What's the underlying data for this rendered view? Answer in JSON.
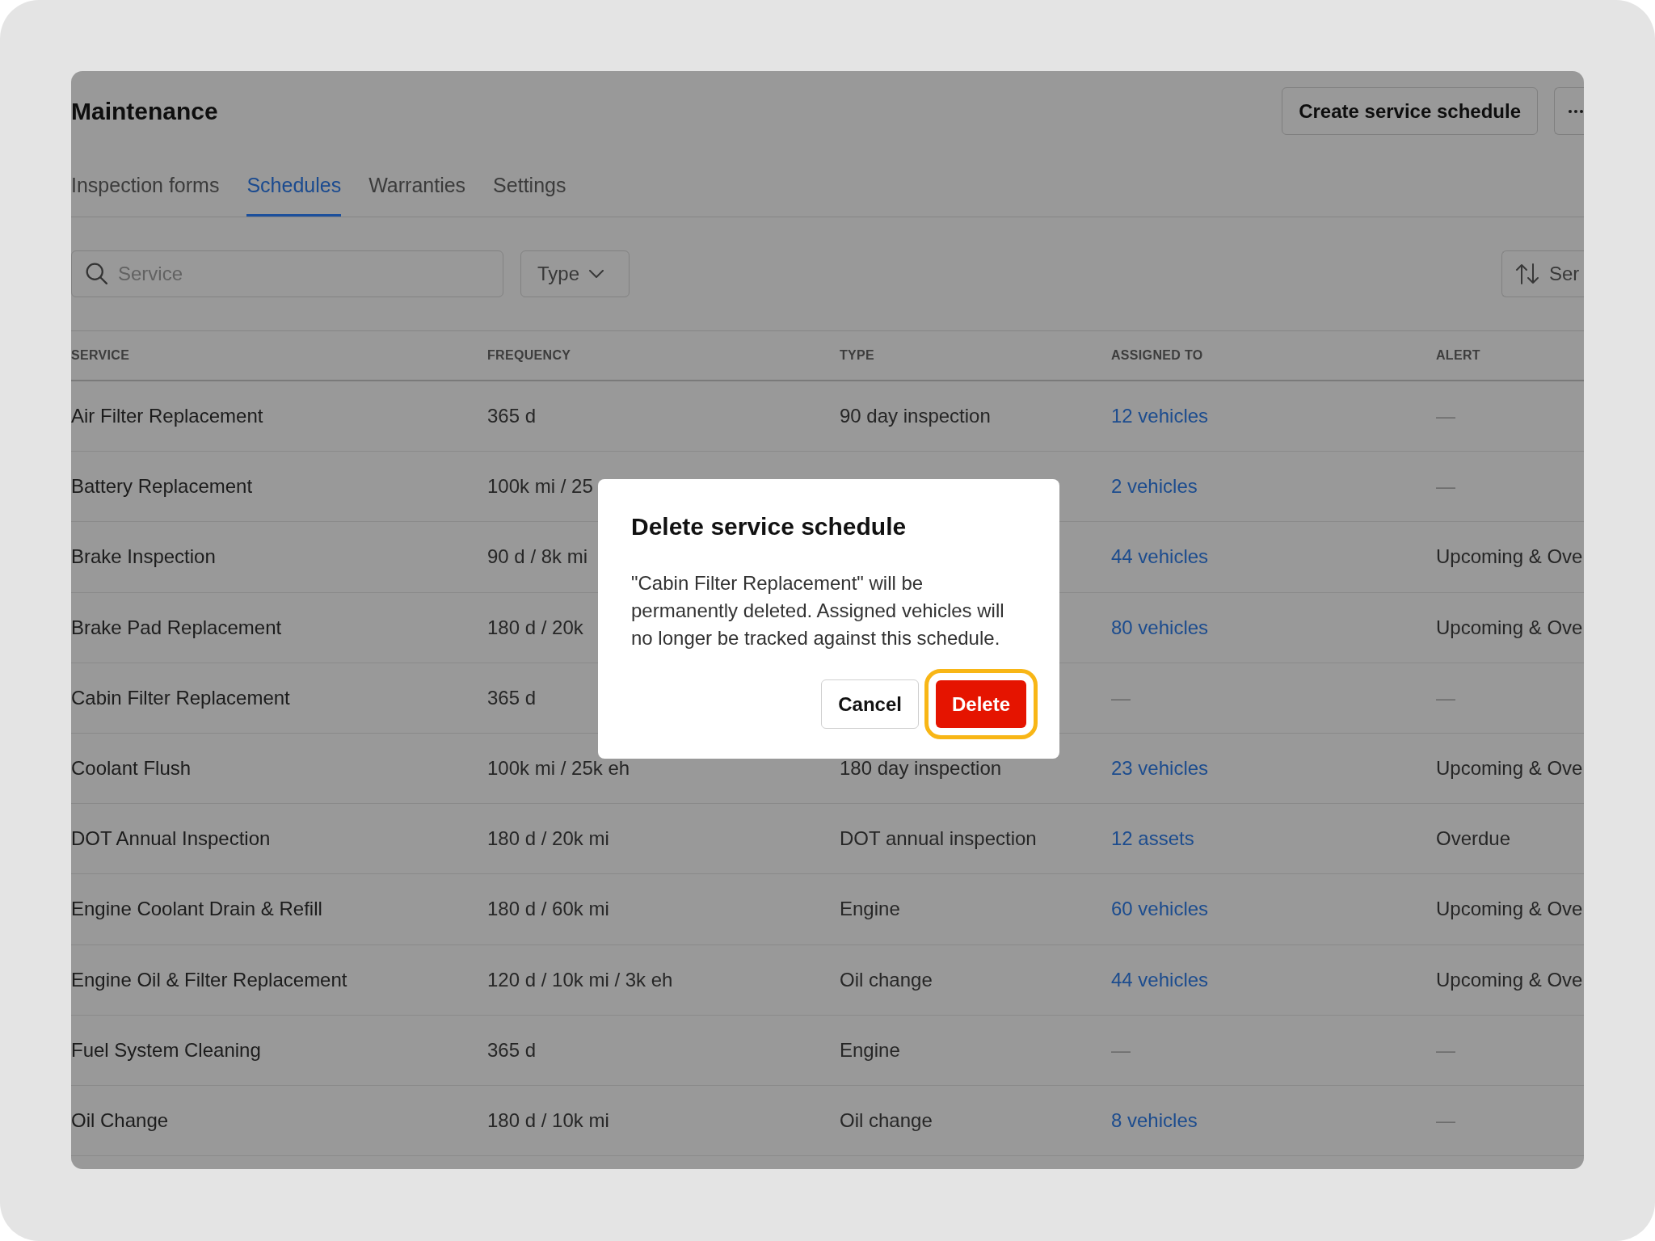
{
  "header": {
    "title": "Maintenance",
    "create_button": "Create service schedule"
  },
  "tabs": [
    {
      "label": "Inspection forms",
      "selected": false
    },
    {
      "label": "Schedules",
      "selected": true
    },
    {
      "label": "Warranties",
      "selected": false
    },
    {
      "label": "Settings",
      "selected": false
    }
  ],
  "toolbar": {
    "search": {
      "placeholder": "Service"
    },
    "type_filter": {
      "label": "Type"
    },
    "sort": {
      "label": "Ser"
    }
  },
  "table": {
    "columns": [
      "SERVICE",
      "FREQUENCY",
      "TYPE",
      "ASSIGNED TO",
      "ALERT"
    ],
    "rows": [
      {
        "service": "Air Filter Replacement",
        "frequency": "365 d",
        "type": "90 day inspection",
        "assigned_to": {
          "text": "12 vehicles",
          "kind": "link"
        },
        "alert": {
          "text": "—",
          "kind": "empty"
        }
      },
      {
        "service": "Battery Replacement",
        "frequency": "100k mi / 25",
        "assigned_to": {
          "text": "2 vehicles",
          "kind": "link"
        },
        "alert": {
          "text": "—",
          "kind": "empty"
        }
      },
      {
        "service": "Brake Inspection",
        "frequency": "90 d / 8k mi",
        "assigned_to": {
          "text": "44 vehicles",
          "kind": "link"
        },
        "alert": {
          "text": "Upcoming & Ove",
          "kind": "text"
        }
      },
      {
        "service": "Brake Pad Replacement",
        "frequency": "180 d / 20k",
        "assigned_to": {
          "text": "80 vehicles",
          "kind": "link"
        },
        "alert": {
          "text": "Upcoming & Ove",
          "kind": "text"
        }
      },
      {
        "service": "Cabin Filter Replacement",
        "frequency": "365 d",
        "assigned_to": {
          "text": "—",
          "kind": "empty"
        },
        "alert": {
          "text": "—",
          "kind": "empty"
        }
      },
      {
        "service": "Coolant Flush",
        "frequency": "100k mi / 25k eh",
        "type": "180 day inspection",
        "assigned_to": {
          "text": "23 vehicles",
          "kind": "link"
        },
        "alert": {
          "text": "Upcoming & Ove",
          "kind": "text"
        }
      },
      {
        "service": "DOT Annual Inspection",
        "frequency": "180 d / 20k mi",
        "type": "DOT annual inspection",
        "assigned_to": {
          "text": "12 assets",
          "kind": "link"
        },
        "alert": {
          "text": "Overdue",
          "kind": "text"
        }
      },
      {
        "service": "Engine Coolant Drain & Refill",
        "frequency": "180 d / 60k mi",
        "type": "Engine",
        "assigned_to": {
          "text": "60 vehicles",
          "kind": "link"
        },
        "alert": {
          "text": "Upcoming & Ove",
          "kind": "text"
        }
      },
      {
        "service": "Engine Oil & Filter Replacement",
        "frequency": "120 d / 10k mi / 3k eh",
        "type": "Oil change",
        "assigned_to": {
          "text": "44 vehicles",
          "kind": "link"
        },
        "alert": {
          "text": "Upcoming & Ove",
          "kind": "text"
        }
      },
      {
        "service": "Fuel System Cleaning",
        "frequency": "365 d",
        "type": "Engine",
        "assigned_to": {
          "text": "—",
          "kind": "empty"
        },
        "alert": {
          "text": "—",
          "kind": "empty"
        }
      },
      {
        "service": "Oil Change",
        "frequency": "180 d / 10k mi",
        "type": "Oil change",
        "assigned_to": {
          "text": "8 vehicles",
          "kind": "link"
        },
        "alert": {
          "text": "—",
          "kind": "empty"
        }
      }
    ]
  },
  "dialog": {
    "title": "Delete service schedule",
    "message": "\"Cabin Filter Replacement\" will be permanently deleted. Assigned vehicles will no longer be tracked against this schedule.",
    "buttons": [
      {
        "label": "Cancel",
        "kind": "secondary",
        "focused": false
      },
      {
        "label": "Delete",
        "kind": "danger",
        "focused": true
      }
    ]
  }
}
